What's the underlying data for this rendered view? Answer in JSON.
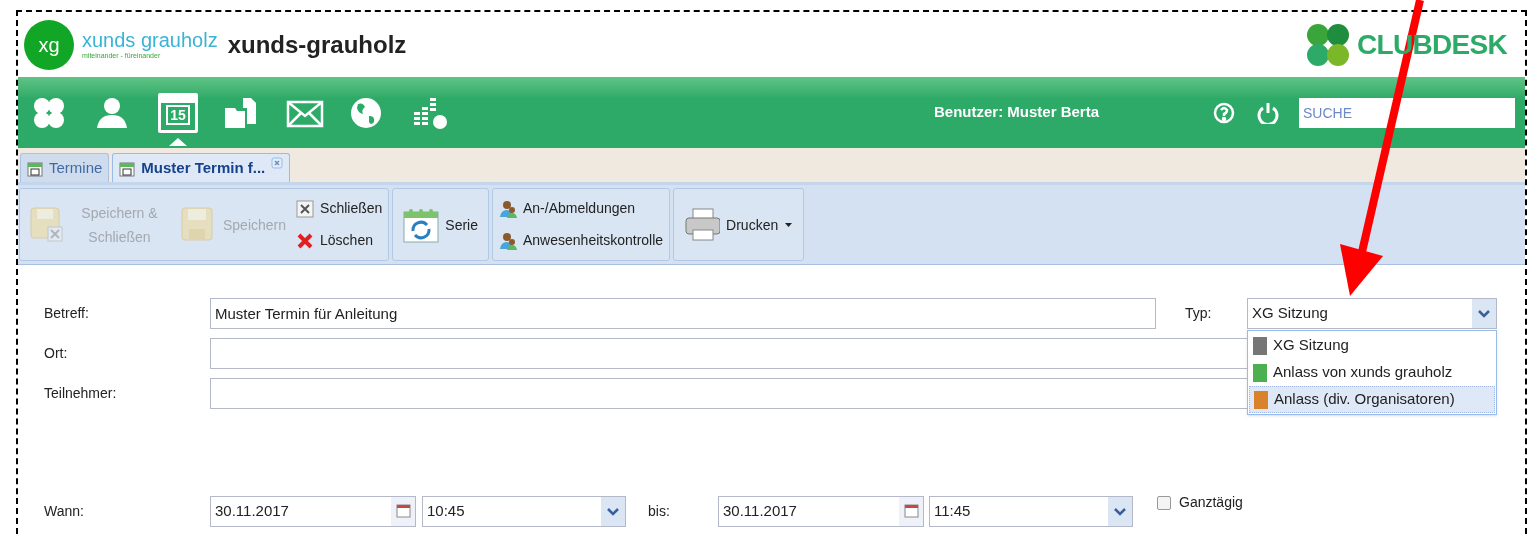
{
  "header": {
    "logo_mark": "xg",
    "logo_name": "xunds grauholz",
    "logo_tagline": "miteinander - füreinander",
    "title": "xunds-grauholz",
    "brand": "CLUBDESK"
  },
  "nav": {
    "icons": [
      {
        "kind": "clover",
        "selected": false
      },
      {
        "kind": "person",
        "selected": false
      },
      {
        "kind": "calendar",
        "label": "15",
        "selected": true
      },
      {
        "kind": "documents",
        "selected": false
      },
      {
        "kind": "mail",
        "selected": false
      },
      {
        "kind": "globe",
        "selected": false
      },
      {
        "kind": "finance",
        "selected": false
      }
    ],
    "user": "Benutzer: Muster Berta",
    "search": {
      "placeholder": "SUCHE"
    }
  },
  "tabs": [
    {
      "label": "Termine",
      "selected": false,
      "closable": false
    },
    {
      "label": "Muster Termin f...",
      "selected": true,
      "closable": true
    }
  ],
  "toolbar": {
    "groups": [
      {
        "buttons": [
          {
            "kind": "save-close",
            "label": "Speichern & Schließen",
            "disabled": true
          },
          {
            "kind": "save",
            "label": "Speichern",
            "disabled": true
          }
        ],
        "small_buttons": [
          {
            "kind": "close",
            "label": "Schließen"
          },
          {
            "kind": "delete",
            "label": "Löschen"
          }
        ]
      },
      {
        "buttons": [
          {
            "kind": "series",
            "label": "Serie",
            "disabled": false
          }
        ]
      },
      {
        "small_buttons": [
          {
            "kind": "people",
            "label": "An-/Abmeldungen"
          },
          {
            "kind": "people",
            "label": "Anwesenheitskontrolle"
          }
        ]
      },
      {
        "buttons": [
          {
            "kind": "print",
            "label": "Drucken",
            "disabled": false,
            "menu": true
          }
        ]
      }
    ]
  },
  "form": {
    "fields": [
      {
        "label": "Betreff:",
        "value": "Muster Termin für Anleitung"
      },
      {
        "label": "Ort:"
      },
      {
        "label": "Teilnehmer:"
      }
    ],
    "type": {
      "label": "Typ:",
      "value": "XG Sitzung",
      "expanded": true,
      "options": [
        {
          "label": "XG Sitzung",
          "color": "#767676",
          "highlighted": false
        },
        {
          "label": "Anlass von xunds grauholz",
          "color": "#4caf50",
          "highlighted": false
        },
        {
          "label": "Anlass (div. Organisatoren)",
          "color": "#d9822b",
          "highlighted": true
        }
      ]
    },
    "when": {
      "label": "Wann:",
      "start_date": "30.11.2017",
      "start_time": "10:45",
      "until_label": "bis:",
      "end_date": "30.11.2017",
      "end_time": "11:45",
      "all_day": {
        "label": "Ganztägig",
        "checked": false
      }
    }
  }
}
